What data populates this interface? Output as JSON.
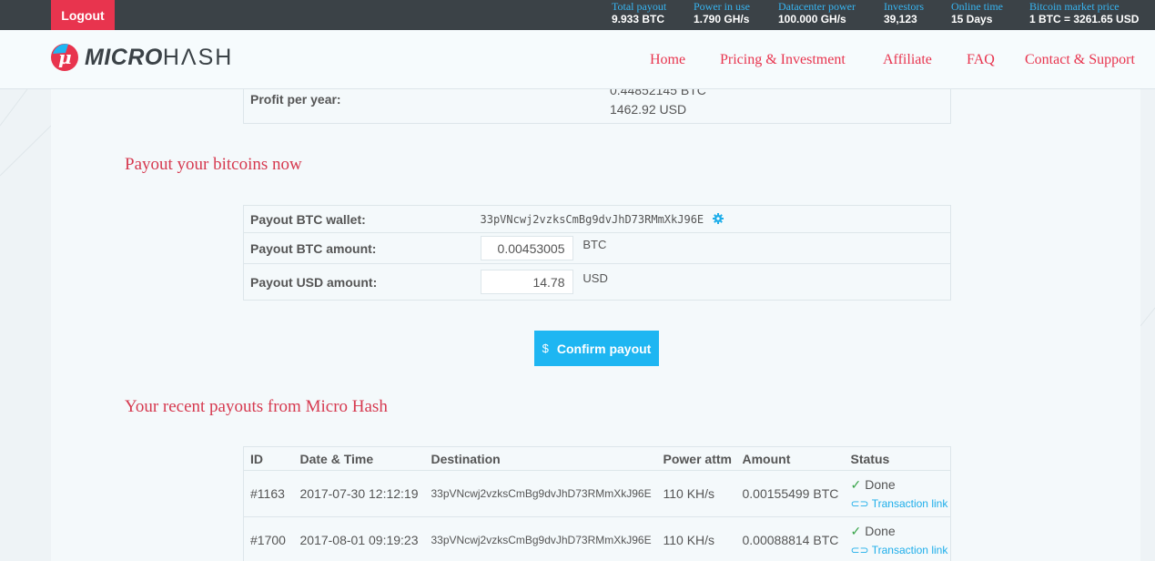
{
  "topbar": {
    "logout_label": "Logout",
    "stats": [
      {
        "label": "Total payout",
        "value": "9.933 BTC"
      },
      {
        "label": "Power in use",
        "value": "1.790 GH/s"
      },
      {
        "label": "Datacenter power",
        "value": "100.000 GH/s"
      },
      {
        "label": "Investors",
        "value": "39,123"
      },
      {
        "label": "Online time",
        "value": "15 Days"
      },
      {
        "label": "Bitcoin market price",
        "value": "1 BTC = 3261.65 USD"
      }
    ]
  },
  "header": {
    "logo_mu": "μ",
    "logo_bold": "MICRO",
    "logo_light": "HΛSH",
    "nav": [
      "Home",
      "Pricing & Investment",
      "Affiliate",
      "FAQ",
      "Contact & Support"
    ]
  },
  "profit": {
    "label": "Profit per year:",
    "btc": "0.44852145 BTC",
    "usd": "1462.92 USD"
  },
  "payout_section": {
    "title": "Payout your bitcoins now",
    "wallet_label": "Payout BTC wallet:",
    "wallet_value": "33pVNcwj2vzksCmBg9dvJhD73RMmXkJ96E",
    "btc_label": "Payout BTC amount:",
    "btc_value": "0.00453005",
    "btc_unit": "BTC",
    "usd_label": "Payout USD amount:",
    "usd_value": "14.78",
    "usd_unit": "USD",
    "confirm_icon": "$",
    "confirm_label": "Confirm payout"
  },
  "recent_payouts": {
    "title": "Your recent payouts from Micro Hash",
    "columns": [
      "ID",
      "Date & Time",
      "Destination",
      "Power attm",
      "Amount",
      "Status"
    ],
    "rows": [
      {
        "id": "#1163",
        "datetime": "2017-07-30 12:12:19",
        "destination": "33pVNcwj2vzksCmBg9dvJhD73RMmXkJ96E",
        "power": "110 KH/s",
        "amount": "0.00155499 BTC",
        "status": "Done",
        "link": "Transaction link"
      },
      {
        "id": "#1700",
        "datetime": "2017-08-01 09:19:23",
        "destination": "33pVNcwj2vzksCmBg9dvJhD73RMmXkJ96E",
        "power": "110 KH/s",
        "amount": "0.00088814 BTC",
        "status": "Done",
        "link": "Transaction link"
      }
    ]
  },
  "colors": {
    "accent_red": "#e8344e",
    "accent_blue": "#1eb6f2",
    "topbar_bg": "#3b4247",
    "done_green": "#3aa54a"
  }
}
